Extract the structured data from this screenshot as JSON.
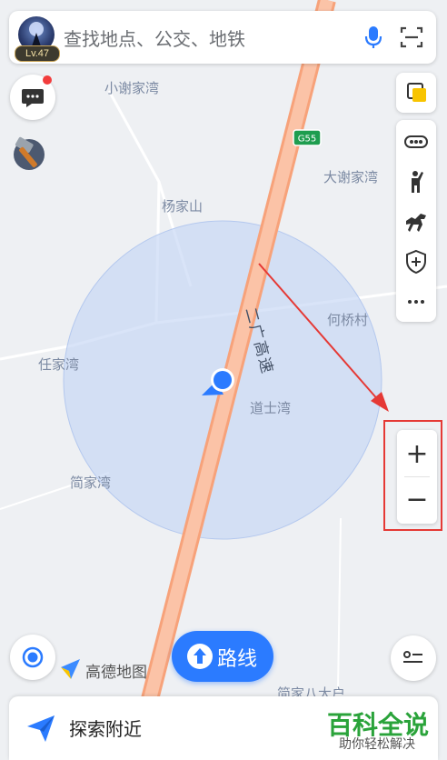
{
  "search": {
    "level": "Lv.47",
    "placeholder": "查找地点、公交、地铁"
  },
  "map": {
    "highway_code": "G55",
    "highway_name": "二广高速",
    "places": [
      {
        "name": "小谢家湾"
      },
      {
        "name": "杨家山"
      },
      {
        "name": "大谢家湾"
      },
      {
        "name": "何桥村"
      },
      {
        "name": "任家湾"
      },
      {
        "name": "道士湾"
      },
      {
        "name": "简家湾"
      },
      {
        "name": "简家八大户"
      }
    ]
  },
  "zoom": {
    "in_label": "+",
    "out_label": "−"
  },
  "brand": {
    "logo_text": "高德地图"
  },
  "route": {
    "label": "路线"
  },
  "bottom": {
    "explore_label": "探索附近"
  },
  "watermark": {
    "main": "百科全说",
    "sub": "助你轻松解决"
  },
  "colors": {
    "accent": "#2b7bff",
    "highway": "#f7a27a",
    "highlight": "#e53935",
    "watermark": "#2aa33a"
  }
}
